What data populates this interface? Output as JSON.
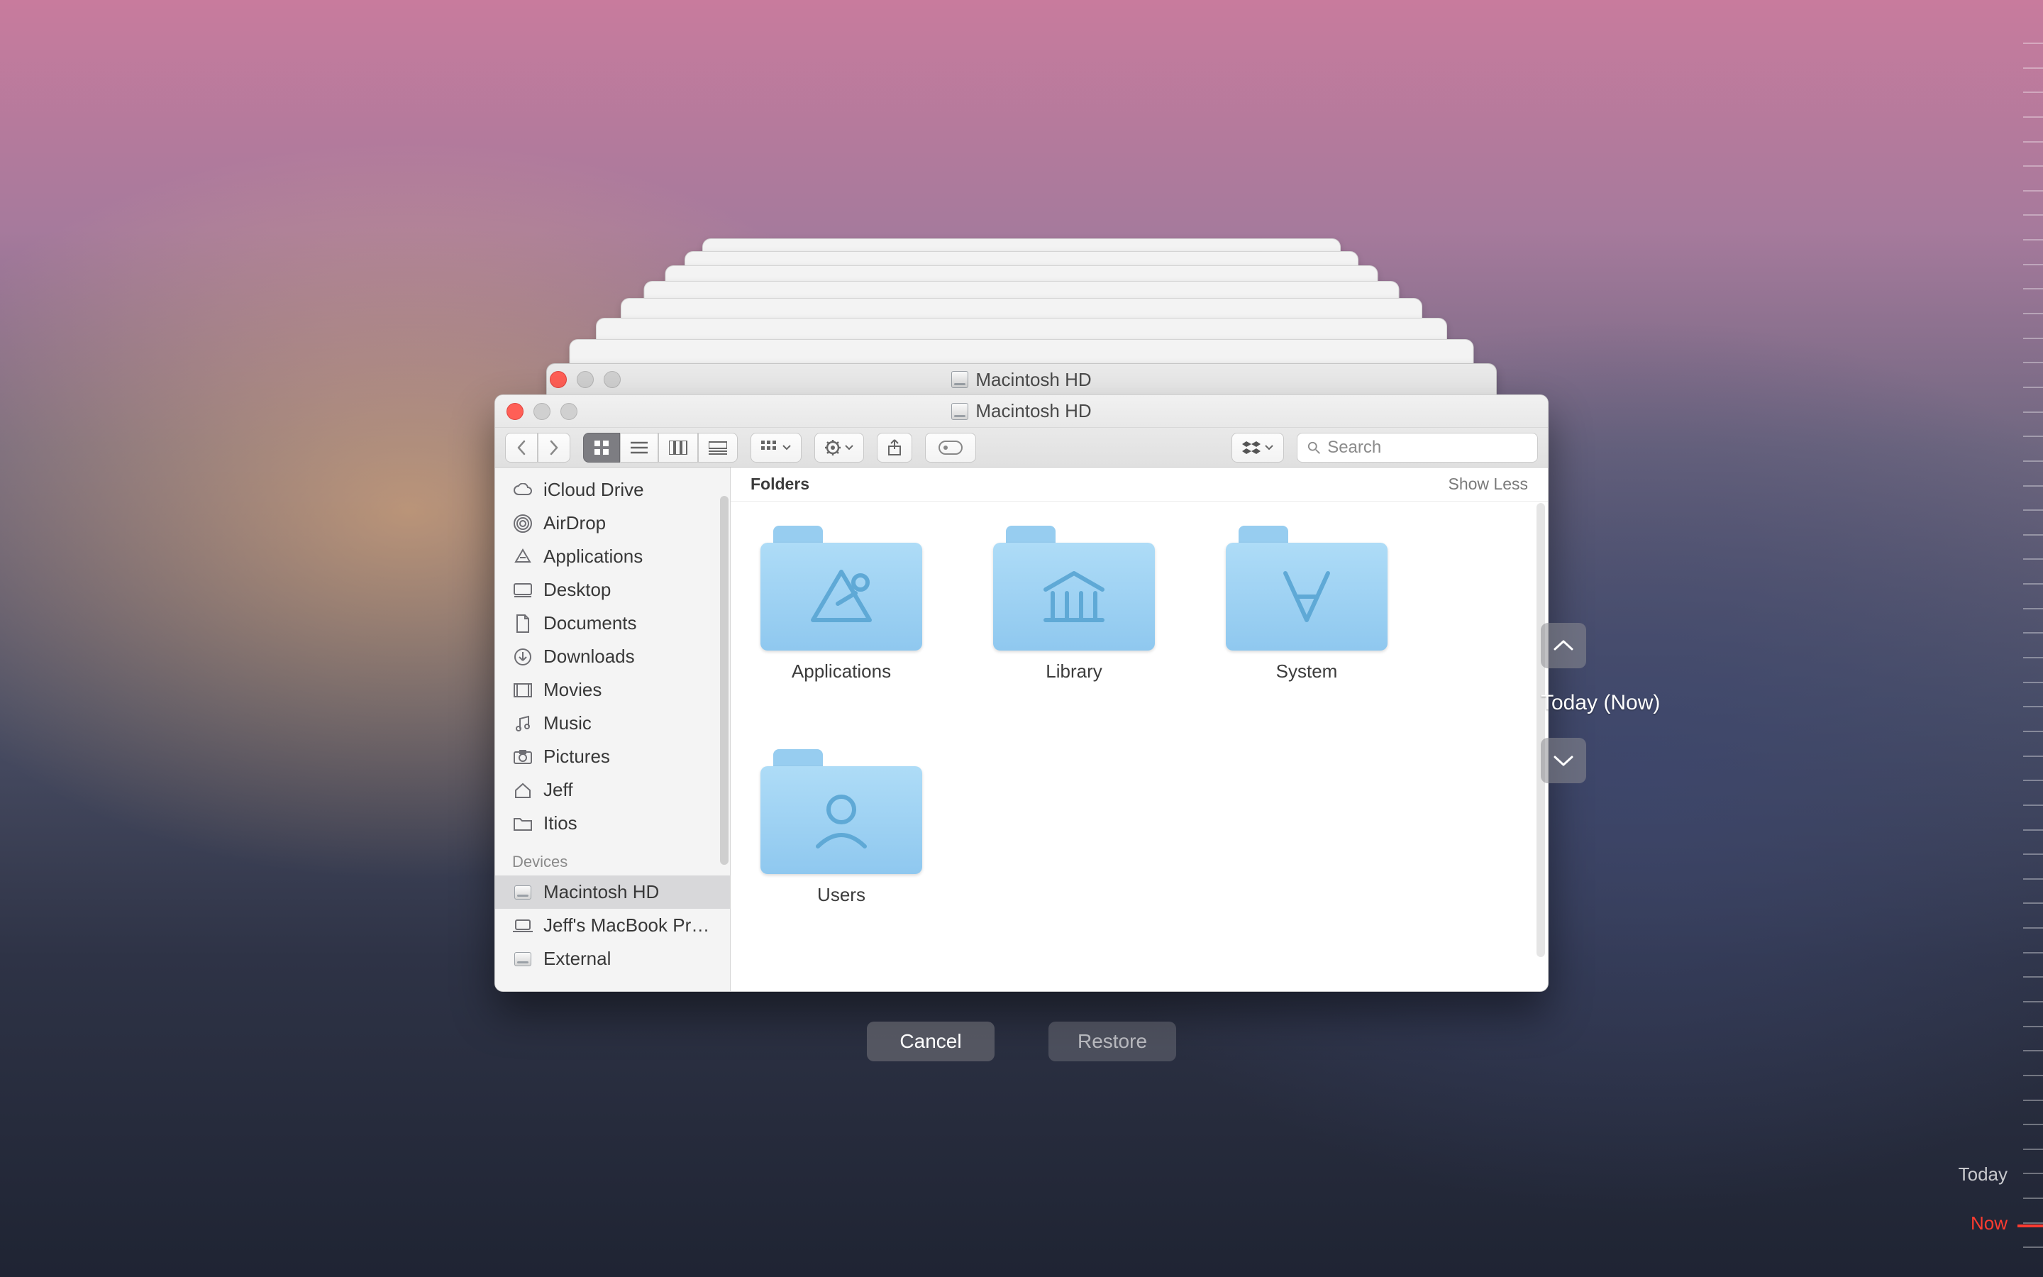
{
  "window": {
    "title": "Macintosh HD",
    "behind_title": "Macintosh HD"
  },
  "toolbar": {
    "search_placeholder": "Search"
  },
  "sidebar": {
    "favorites": [
      {
        "label": "iCloud Drive",
        "icon": "cloud"
      },
      {
        "label": "AirDrop",
        "icon": "airdrop"
      },
      {
        "label": "Applications",
        "icon": "app"
      },
      {
        "label": "Desktop",
        "icon": "desktop"
      },
      {
        "label": "Documents",
        "icon": "doc"
      },
      {
        "label": "Downloads",
        "icon": "download"
      },
      {
        "label": "Movies",
        "icon": "movie"
      },
      {
        "label": "Music",
        "icon": "music"
      },
      {
        "label": "Pictures",
        "icon": "pictures"
      },
      {
        "label": "Jeff",
        "icon": "home"
      },
      {
        "label": "Itios",
        "icon": "folder"
      }
    ],
    "devices_header": "Devices",
    "devices": [
      {
        "label": "Macintosh HD",
        "icon": "hd",
        "selected": true
      },
      {
        "label": "Jeff's MacBook Pr…",
        "icon": "laptop"
      },
      {
        "label": "External",
        "icon": "hd"
      }
    ]
  },
  "content": {
    "header": "Folders",
    "show_less": "Show Less",
    "folders": [
      {
        "label": "Applications",
        "glyph": "apps"
      },
      {
        "label": "Library",
        "glyph": "library"
      },
      {
        "label": "System",
        "glyph": "system"
      },
      {
        "label": "Users",
        "glyph": "users"
      }
    ]
  },
  "actions": {
    "cancel": "Cancel",
    "restore": "Restore"
  },
  "timeline": {
    "current": "Today (Now)",
    "today": "Today",
    "now": "Now"
  }
}
